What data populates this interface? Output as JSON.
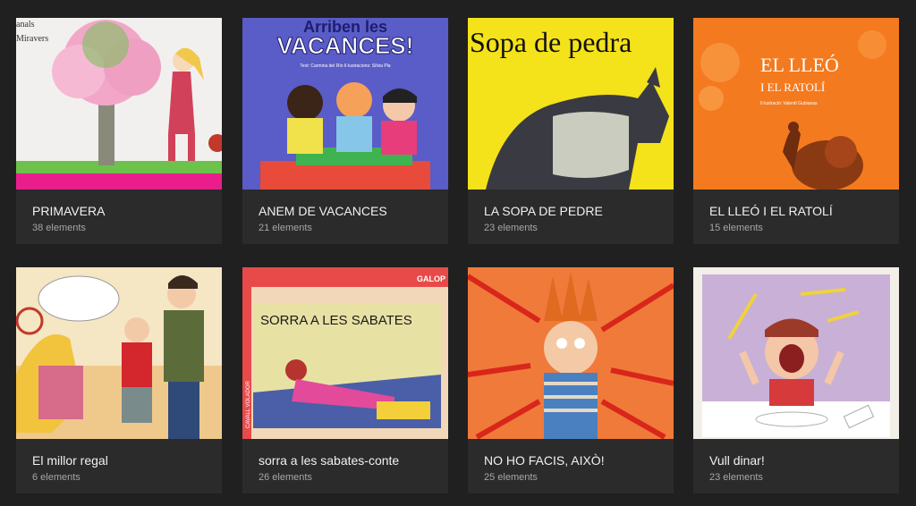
{
  "albums": [
    {
      "title": "PRIMAVERA",
      "count": "38 elements",
      "cover_text": [
        "anals",
        "Miravers"
      ]
    },
    {
      "title": "ANEM DE VACANCES",
      "count": "21 elements",
      "cover_text": [
        "Arriben les",
        "VACANCES!",
        "Text: Carmina del Río   Il·lustracions: Sílvia Pla"
      ]
    },
    {
      "title": "LA SOPA DE PEDRE",
      "count": "23 elements",
      "cover_text": [
        "Sopa de pedra"
      ]
    },
    {
      "title": "EL LLEÓ I EL RATOLÍ",
      "count": "15 elements",
      "cover_text": [
        "EL LLEÓ",
        "I EL RATOLÍ",
        "Il·lustració: Valentí Gubianas"
      ]
    },
    {
      "title": "El millor regal",
      "count": "6 elements",
      "cover_text": []
    },
    {
      "title": "sorra a les sabates-conte",
      "count": "26 elements",
      "cover_text": [
        "GALOP",
        "SORRA A LES SABATES",
        "CAVALL VOLADOR"
      ]
    },
    {
      "title": "NO HO FACIS, AIXÒ!",
      "count": "25 elements",
      "cover_text": []
    },
    {
      "title": "Vull dinar!",
      "count": "23 elements",
      "cover_text": []
    }
  ]
}
